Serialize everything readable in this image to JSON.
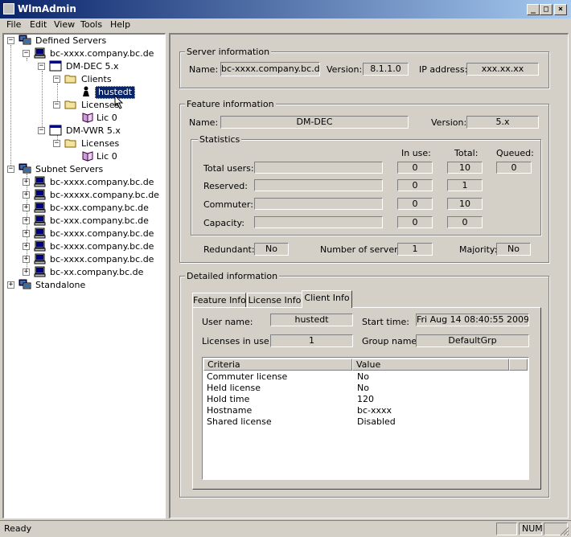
{
  "window": {
    "title": "WlmAdmin"
  },
  "menu": [
    "File",
    "Edit",
    "View",
    "Tools",
    "Help"
  ],
  "tree": {
    "defined_servers": "Defined Servers",
    "server1": "bc-xxxx.company.bc.de",
    "product1": "DM-DEC 5.x",
    "clients": "Clients",
    "client_user": "hustedt",
    "licenses": "Licenses",
    "lic0": "Lic 0",
    "product2": "DM-VWR 5.x",
    "licenses2": "Licenses",
    "lic0b": "Lic 0",
    "subnet_servers": "Subnet Servers",
    "subnet": [
      "bc-xxxx.company.bc.de",
      "bc-xxxxx.company.bc.de",
      "bc-xxx.company.bc.de",
      "bc-xxx.company.bc.de",
      "bc-xxxx.company.bc.de",
      "bc-xxxx.company.bc.de",
      "bc-xxxx.company.bc.de",
      "bc-xx.company.bc.de"
    ],
    "standalone": "Standalone"
  },
  "server_info": {
    "title": "Server information",
    "name_label": "Name:",
    "name_value": "bc-xxxx.company.bc.de",
    "version_label": "Version:",
    "version_value": "8.1.1.0",
    "ip_label": "IP address:",
    "ip_value": "xxx.xx.xx"
  },
  "feature_info": {
    "title": "Feature information",
    "name_label": "Name:",
    "name_value": "DM-DEC",
    "version_label": "Version:",
    "version_value": "5.x",
    "statistics_title": "Statistics",
    "col_inuse": "In use:",
    "col_total": "Total:",
    "col_queued": "Queued:",
    "rows": [
      {
        "label": "Total users:",
        "inuse": "0",
        "total": "10",
        "queued": "0"
      },
      {
        "label": "Reserved:",
        "inuse": "0",
        "total": "1"
      },
      {
        "label": "Commuter:",
        "inuse": "0",
        "total": "10"
      },
      {
        "label": "Capacity:",
        "inuse": "0",
        "total": "0"
      }
    ],
    "redundant_label": "Redundant:",
    "redundant_value": "No",
    "num_servers_label": "Number of servers:",
    "num_servers_value": "1",
    "majority_label": "Majority:",
    "majority_value": "No"
  },
  "detailed_info": {
    "title": "Detailed information",
    "tabs": [
      "Feature Info",
      "License Info",
      "Client Info"
    ],
    "active_tab": "Client Info",
    "user_name_label": "User name:",
    "user_name_value": "hustedt",
    "start_time_label": "Start time:",
    "start_time_value": "Fri Aug 14 08:40:55 2009",
    "licenses_in_use_label": "Licenses in use:",
    "licenses_in_use_value": "1",
    "group_name_label": "Group name:",
    "group_name_value": "DefaultGrp",
    "list_headers": [
      "Criteria",
      "Value"
    ],
    "list_rows": [
      {
        "criteria": "Commuter license",
        "value": "No"
      },
      {
        "criteria": "Held license",
        "value": "No"
      },
      {
        "criteria": "Hold time",
        "value": "120"
      },
      {
        "criteria": "Hostname",
        "value": "bc-xxxx"
      },
      {
        "criteria": "Shared license",
        "value": "Disabled"
      }
    ]
  },
  "status": {
    "text": "Ready",
    "num": "NUM"
  }
}
